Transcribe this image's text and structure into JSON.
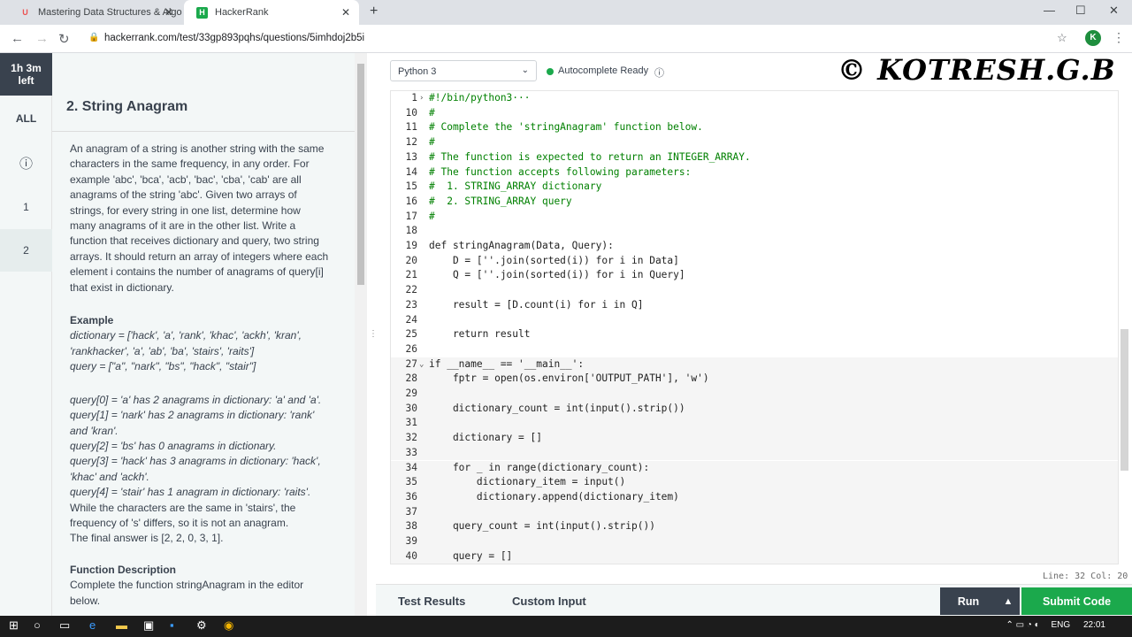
{
  "browser": {
    "tabs": [
      {
        "title": "Mastering Data Structures & Algo"
      },
      {
        "title": "HackerRank"
      }
    ],
    "url": "hackerrank.com/test/33gp893pqhs/questions/5imhdoj2b5i",
    "profile_initial": "K"
  },
  "rail": {
    "timer_line1": "1h 3m",
    "timer_line2": "left",
    "items": [
      {
        "label": "ALL"
      },
      {
        "label": "ⓘ"
      },
      {
        "label": "1"
      },
      {
        "label": "2"
      }
    ]
  },
  "problem": {
    "title": "2. String Anagram",
    "intro": [
      "An anagram of a string is another string with the same",
      "characters in the same frequency, in any order. For",
      "example 'abc', 'bca', 'acb', 'bac', 'cba', 'cab' are all",
      "anagrams of the string 'abc'. Given two arrays of",
      "strings, for every string in one list, determine how",
      "many anagrams of it are in the other list. Write a",
      "function that receives dictionary and query, two string",
      "arrays. It should return an array of integers where each",
      "element i contains the number of anagrams of query[i]",
      "that exist in dictionary."
    ],
    "example_heading": "Example",
    "example_lines": [
      "dictionary = ['hack', 'a', 'rank', 'khac', 'ackh', 'kran',",
      "'rankhacker', 'a', 'ab', 'ba', 'stairs', 'raits']",
      "query = [\"a\", \"nark\", \"bs\", \"hack\", \"stair\"]"
    ],
    "explain_lines": [
      "query[0] = 'a' has 2 anagrams in dictionary: 'a' and 'a'.",
      "query[1] = 'nark' has 2 anagrams in dictionary: 'rank'",
      "and 'kran'.",
      "query[2] = 'bs' has 0 anagrams in dictionary.",
      "query[3] = 'hack' has 3 anagrams in dictionary: 'hack',",
      "'khac' and 'ackh'.",
      "query[4] = 'stair' has 1 anagram in dictionary: 'raits'.",
      "While the characters are the same in 'stairs', the",
      "frequency of 's' differs, so it is not an anagram.",
      "The final answer is [2, 2, 0, 3, 1]."
    ],
    "fd_heading": "Function Description",
    "fd_lines": [
      "Complete the function stringAnagram in the editor",
      "below."
    ]
  },
  "editor": {
    "language": "Python 3",
    "autocomplete": "Autocomplete Ready",
    "watermark": "© KOTRESH.G.B",
    "status": "Line: 32 Col: 20",
    "lines": [
      {
        "n": "1",
        "t": "#!/bin/python3···",
        "fold": "›",
        "cls": "cm"
      },
      {
        "n": "10",
        "t": "#",
        "cls": "cm"
      },
      {
        "n": "11",
        "t": "# Complete the 'stringAnagram' function below.",
        "cls": "cm"
      },
      {
        "n": "12",
        "t": "#",
        "cls": "cm"
      },
      {
        "n": "13",
        "t": "# The function is expected to return an INTEGER_ARRAY.",
        "cls": "cm"
      },
      {
        "n": "14",
        "t": "# The function accepts following parameters:",
        "cls": "cm"
      },
      {
        "n": "15",
        "t": "#  1. STRING_ARRAY dictionary",
        "cls": "cm"
      },
      {
        "n": "16",
        "t": "#  2. STRING_ARRAY query",
        "cls": "cm"
      },
      {
        "n": "17",
        "t": "#",
        "cls": "cm"
      },
      {
        "n": "18",
        "t": ""
      },
      {
        "n": "19",
        "t": "def stringAnagram(Data, Query):",
        "cls": "kw0"
      },
      {
        "n": "20",
        "t": "    D = [''.join(sorted(i)) for i in Data]"
      },
      {
        "n": "21",
        "t": "    Q = [''.join(sorted(i)) for i in Query]"
      },
      {
        "n": "22",
        "t": ""
      },
      {
        "n": "23",
        "t": "    result = [D.count(i) for i in Q]"
      },
      {
        "n": "24",
        "t": ""
      },
      {
        "n": "25",
        "t": "    return result"
      },
      {
        "n": "26",
        "t": ""
      },
      {
        "n": "27",
        "t": "if __name__ == '__main__':",
        "fold": "⌄"
      },
      {
        "n": "28",
        "t": "    fptr = open(os.environ['OUTPUT_PATH'], 'w')"
      },
      {
        "n": "29",
        "t": ""
      },
      {
        "n": "30",
        "t": "    dictionary_count = int(input().strip())"
      },
      {
        "n": "31",
        "t": ""
      },
      {
        "n": "32",
        "t": "    dictionary = []"
      },
      {
        "n": "33",
        "t": ""
      },
      {
        "n": "34",
        "t": "    for _ in range(dictionary_count):"
      },
      {
        "n": "35",
        "t": "        dictionary_item = input()"
      },
      {
        "n": "36",
        "t": "        dictionary.append(dictionary_item)"
      },
      {
        "n": "37",
        "t": ""
      },
      {
        "n": "38",
        "t": "    query_count = int(input().strip())"
      },
      {
        "n": "39",
        "t": ""
      },
      {
        "n": "40",
        "t": "    query = []"
      }
    ]
  },
  "bottom": {
    "tab_results": "Test Results",
    "tab_custom": "Custom Input",
    "run": "Run",
    "up": "▲",
    "submit": "Submit Code"
  },
  "taskbar": {
    "lang": "ENG",
    "time": "22:01"
  },
  "colors": {
    "accent_green": "#1ba94c",
    "dark": "#39424e"
  }
}
